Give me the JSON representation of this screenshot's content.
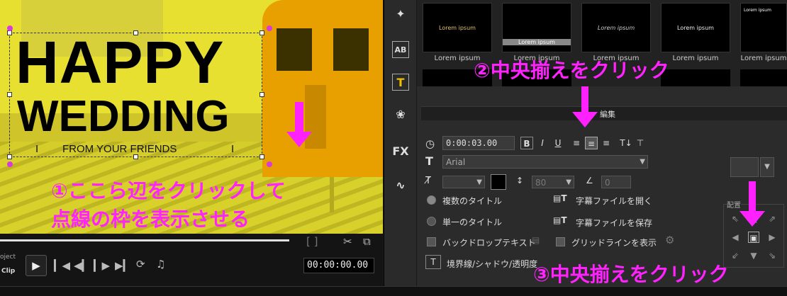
{
  "preview": {
    "title_line1": "HAPPY",
    "title_line2": "WEDDING",
    "title_line3": "FROM YOUR FRIENDS",
    "bar_left": "I",
    "bar_right": "I"
  },
  "annotations": {
    "step1_line1": "①ここら辺をクリックして",
    "step1_line2": "点線の枠を表示させる",
    "step2": "②中央揃えをクリック",
    "step3": "③中央揃えをクリック"
  },
  "transport": {
    "project_label": "oject",
    "clip_label": "Clip",
    "timecode": "00:00:00.00"
  },
  "library": {
    "items": [
      {
        "thumb_text": "Lorem ipsum",
        "caption": "Lorem ipsum"
      },
      {
        "thumb_text": "Lorem ipsum",
        "caption": "Lorem ipsum"
      },
      {
        "thumb_text": "Lorem ipsum",
        "caption": "Lorem ipsum"
      },
      {
        "thumb_text": "Lorem ipsum",
        "caption": "Lorem ipsum"
      },
      {
        "thumb_text": "Lorem ipsum",
        "caption": "Lorem ipsum"
      }
    ]
  },
  "editor": {
    "tab_label": "編集",
    "duration": "0:00:03.00",
    "font_name": "Arial",
    "font_size": "80",
    "rotation": "0",
    "multi_title": "複数のタイトル",
    "single_title": "単一のタイトル",
    "open_subtitle": "字幕ファイルを開く",
    "save_subtitle": "字幕ファイルを保存",
    "backdrop_text": "バックドロップテキスト",
    "gridline": "グリッドラインを表示",
    "border_shadow": "境界線/シャドウ/透明度",
    "align_label": "配置"
  },
  "colors": {
    "annotation": "#ff22ff",
    "preview_bg": "#e8e030"
  }
}
